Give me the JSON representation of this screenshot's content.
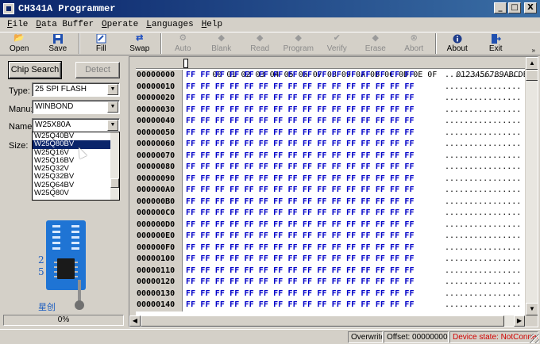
{
  "window": {
    "title": "CH341A Programmer",
    "min": "_",
    "max": "□",
    "close": "X"
  },
  "menu": [
    {
      "label": "File",
      "u": "F",
      "rest": "ile"
    },
    {
      "label": "Data Buffer",
      "u": "D",
      "rest": "ata Buffer"
    },
    {
      "label": "Operate",
      "u": "O",
      "rest": "perate"
    },
    {
      "label": "Languages",
      "u": "L",
      "rest": "anguages"
    },
    {
      "label": "Help",
      "u": "H",
      "rest": "elp"
    }
  ],
  "toolbar": {
    "open": "Open",
    "save": "Save",
    "fill": "Fill",
    "swap": "Swap",
    "auto": "Auto",
    "blank": "Blank",
    "read": "Read",
    "program": "Program",
    "verify": "Verify",
    "erase": "Erase",
    "abort": "Abort",
    "about": "About",
    "exit": "Exit"
  },
  "left": {
    "chip_search": "Chip Search",
    "detect": "Detect",
    "type_label": "Type:",
    "type_value": "25 SPI FLASH",
    "manu_label": "Manu:",
    "manu_value": "WINBOND",
    "name_label": "Name:",
    "name_value": "W25X80A",
    "size_label": "Size:",
    "name_options": [
      "W25Q40BV",
      "W25Q80BV",
      "W25Q16V",
      "W25Q16BV",
      "W25Q32V",
      "W25Q32BV",
      "W25Q64BV",
      "W25Q80V"
    ],
    "selected_option": "W25Q80BV",
    "board_num_top": "2",
    "board_num_bottom": "5",
    "brand": "星创",
    "progress": "0%"
  },
  "hex": {
    "header_cols": [
      "00",
      "01",
      "02",
      "03",
      "04",
      "05",
      "06",
      "07",
      "08",
      "09",
      "0A",
      "0B",
      "0C",
      "0D",
      "0E",
      "0F"
    ],
    "ascii_header": "0123456789ABCDEF",
    "byte_value": "FF",
    "ascii_fill": "................",
    "addresses": [
      "00000000",
      "00000010",
      "00000020",
      "00000030",
      "00000040",
      "00000050",
      "00000060",
      "00000070",
      "00000080",
      "00000090",
      "000000A0",
      "000000B0",
      "000000C0",
      "000000D0",
      "000000E0",
      "000000F0",
      "00000100",
      "00000110",
      "00000120",
      "00000130",
      "00000140"
    ]
  },
  "status": {
    "mode": "Overwrite",
    "offset": "Offset: 00000000, 0",
    "device": "Device state: NotConnect."
  },
  "colors": {
    "title_gradient_start": "#0a246a",
    "hex_bytes": "#0000c8",
    "device_alert": "#d00000"
  }
}
